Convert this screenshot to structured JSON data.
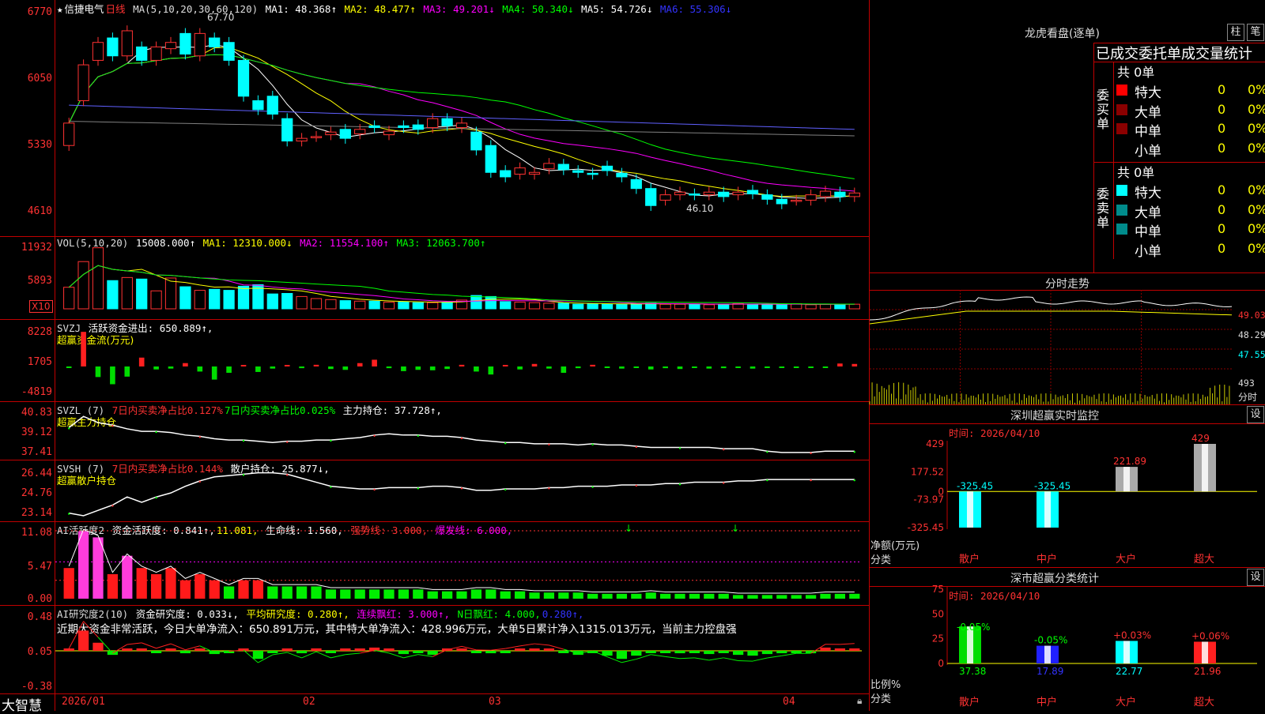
{
  "colors": {
    "up": "#ff3232",
    "down": "#00ffff",
    "ma1": "#ffffff",
    "ma2": "#ffff00",
    "ma3": "#ff00ff",
    "ma4": "#00ff00",
    "ma5": "#6060ff",
    "ma6": "#808080"
  },
  "main": {
    "star": "★",
    "stock_name": "信捷电气",
    "period": "日线",
    "ma_def": "MA(5,10,20,30,60,120)",
    "ma1": "MA1: 48.368↑",
    "ma2": "MA2: 48.477↑",
    "ma3": "MA3: 49.201↓",
    "ma4": "MA4: 50.340↓",
    "ma5": "MA5: 54.726↓",
    "ma6": "MA6: 55.306↓",
    "yticks": [
      "6770",
      "6050",
      "5330",
      "4610"
    ],
    "high_label": "67.70",
    "low_label": "46.10",
    "closes": [
      55.5,
      62.0,
      64.5,
      63.0,
      65.8,
      62.5,
      64.0,
      64.5,
      63.2,
      65.5,
      64.0,
      62.5,
      58.5,
      57.0,
      56.5,
      53.5,
      53.8,
      54.0,
      54.5,
      53.8,
      54.8,
      55.0,
      54.6,
      55.0,
      54.8,
      56.0,
      55.2,
      55.5,
      52.5,
      50.0,
      49.5,
      50.5,
      50.0,
      51.0,
      50.3,
      50.0,
      49.8,
      50.2,
      49.5,
      48.2,
      46.3,
      47.5,
      47.8,
      47.5,
      47.8,
      47.3,
      47.8,
      47.6,
      47.0,
      46.5,
      46.9,
      47.5,
      47.9,
      47.3,
      47.7
    ],
    "opens": [
      53.0,
      58.0,
      62.5,
      65.0,
      63.0,
      64.0,
      62.5,
      63.8,
      65.5,
      63.0,
      65.0,
      64.5,
      62.5,
      58.0,
      58.5,
      56.0,
      53.5,
      54.0,
      54.2,
      54.8,
      54.3,
      55.2,
      54.2,
      55.2,
      55.3,
      55.0,
      56.0,
      55.0,
      54.5,
      53.0,
      50.2,
      49.8,
      49.8,
      50.4,
      50.9,
      50.2,
      49.9,
      50.7,
      49.9,
      49.2,
      48.2,
      46.9,
      47.5,
      47.6,
      47.5,
      47.8,
      47.5,
      48.0,
      47.5,
      47.0,
      46.9,
      46.9,
      47.3,
      47.8,
      47.3
    ]
  },
  "vol": {
    "hdr_def": "VOL(5,10,20)",
    "vol": "15008.000↑",
    "ma1": "MA1: 12310.000↓",
    "ma2": "MA2: 11554.100↑",
    "ma3": "MA3: 12063.700↑",
    "yticks": [
      "11932",
      "5893"
    ],
    "x10": "X10",
    "values": [
      4200,
      9200,
      11900,
      5500,
      6100,
      5800,
      3500,
      6000,
      4300,
      3600,
      3800,
      3600,
      4400,
      4700,
      2900,
      3000,
      2400,
      2000,
      1800,
      1600,
      1500,
      1500,
      1300,
      1300,
      1200,
      1200,
      1300,
      1700,
      2600,
      2400,
      1400,
      1300,
      1200,
      1100,
      1100,
      900,
      1000,
      900,
      900,
      1000,
      1100,
      900,
      900,
      900,
      800,
      900,
      1000,
      900,
      800,
      900,
      1000,
      800,
      900,
      900,
      900
    ]
  },
  "svzj": {
    "name": "SVZJ",
    "label": "活跃资金进出: 650.889↑,",
    "sub": "超赢资金流(万元)",
    "yticks": [
      "8228",
      "1705",
      "-4819"
    ],
    "values": [
      -300,
      8200,
      -2500,
      -4200,
      -2400,
      2100,
      -700,
      -500,
      800,
      -1200,
      -3100,
      -1500,
      200,
      -1300,
      -500,
      200,
      -400,
      400,
      -600,
      -800,
      800,
      1600,
      -400,
      -1100,
      -800,
      -900,
      -600,
      400,
      -1200,
      -1900,
      200,
      -700,
      600,
      -500,
      -1500,
      -400,
      400,
      -300,
      -500,
      -300,
      -700,
      -400,
      -600,
      -300,
      -500,
      -400,
      -300,
      -500,
      -200,
      -300,
      -200,
      -300,
      -200,
      700,
      600
    ]
  },
  "svzl": {
    "name": "SVZL (7)",
    "r1": "7日内买卖净占比0.127%",
    "r2": "7日内买卖净占比0.025%",
    "main": "主力持仓: 37.728↑,",
    "sub": "超赢主力持仓",
    "yticks": [
      "40.83",
      "39.12",
      "37.41"
    ],
    "values": [
      39.6,
      40.5,
      40.0,
      39.8,
      39.5,
      39.3,
      39.3,
      39.2,
      39.0,
      38.9,
      38.7,
      38.6,
      38.6,
      38.5,
      38.4,
      38.5,
      38.5,
      38.6,
      38.6,
      38.7,
      38.8,
      39.0,
      39.1,
      39.0,
      39.0,
      38.9,
      38.9,
      38.8,
      38.6,
      38.5,
      38.4,
      38.4,
      38.3,
      38.3,
      38.3,
      38.2,
      38.3,
      38.2,
      38.2,
      38.1,
      38.0,
      38.0,
      38.0,
      38.0,
      38.0,
      37.9,
      37.9,
      37.9,
      37.7,
      37.6,
      37.6,
      37.6,
      37.7,
      37.7,
      37.7
    ]
  },
  "svsh": {
    "name": "SVSH (7)",
    "r1": "7日内买卖净占比0.144%",
    "main": "散户持仓: 25.877↓,",
    "sub": "超赢散户持仓",
    "yticks": [
      "26.44",
      "24.76",
      "23.14"
    ],
    "values": [
      23.4,
      23.2,
      23.6,
      24.0,
      24.6,
      24.2,
      24.6,
      24.9,
      25.4,
      25.8,
      26.1,
      26.2,
      26.3,
      26.4,
      26.4,
      26.3,
      26.0,
      25.7,
      25.4,
      25.3,
      25.2,
      25.2,
      25.3,
      25.3,
      25.3,
      25.4,
      25.4,
      25.3,
      25.1,
      25.1,
      25.2,
      25.2,
      25.2,
      25.3,
      25.3,
      25.4,
      25.4,
      25.4,
      25.5,
      25.5,
      25.5,
      25.6,
      25.6,
      25.7,
      25.7,
      25.7,
      25.8,
      25.8,
      25.9,
      25.9,
      25.9,
      25.9,
      25.9,
      25.9,
      25.9
    ]
  },
  "ai": {
    "name": "AI活跃度2",
    "act": "资金活跃度: 0.841↑,",
    "v2": "11.081,",
    "life": "生命线: 1.560,",
    "strong": "强势线: 3.000,",
    "burst": "爆发线: 6.000,",
    "yticks": [
      "11.08",
      "5.47",
      "0.00"
    ],
    "values": [
      5,
      11,
      10,
      4,
      7,
      5,
      4,
      5,
      3,
      4,
      3,
      2,
      3,
      3,
      2,
      2,
      2,
      2,
      1.5,
      1.5,
      1.5,
      1.5,
      1.5,
      1.5,
      1.5,
      1.2,
      1.2,
      1.2,
      1.5,
      1.5,
      1.2,
      1.2,
      1,
      1,
      1,
      1,
      0.8,
      0.8,
      0.8,
      0.8,
      1,
      0.8,
      0.8,
      0.8,
      0.8,
      0.8,
      0.6,
      0.6,
      0.6,
      0.6,
      0.6,
      0.6,
      0.8,
      0.8,
      0.8
    ]
  },
  "research": {
    "name": "AI研究度2(10)",
    "fund": "资金研究度: 0.033↓,",
    "avg": "平均研究度: 0.280↑,",
    "red": "连续飘红: 3.000↑,",
    "nred": "N日飘红: 4.000,",
    "last": "0.280↑,",
    "desc": "近期大资金非常活跃，今日大单净流入：650.891万元，其中特大单净流入：428.996万元，大单5日累计净入1315.013万元，当前主力控盘强",
    "yticks": [
      "0.48",
      "0.05",
      "-0.38"
    ],
    "values": [
      0.02,
      0.25,
      0.1,
      -0.05,
      0.02,
      0.03,
      -0.02,
      0.02,
      -0.03,
      0.01,
      -0.04,
      -0.02,
      0.0,
      -0.1,
      -0.02,
      0.01,
      -0.03,
      0.03,
      -0.02,
      0.01,
      0.02,
      0.04,
      0.01,
      -0.04,
      -0.02,
      -0.05,
      0.0,
      0.02,
      -0.02,
      -0.03,
      -0.02,
      0.0,
      0.02,
      0.01,
      -0.02,
      -0.05,
      -0.02,
      -0.06,
      -0.1,
      -0.06,
      -0.01,
      -0.02,
      -0.03,
      -0.02,
      -0.04,
      -0.02,
      -0.05,
      -0.06,
      -0.04,
      -0.03,
      -0.02,
      -0.03,
      0.04,
      0.03,
      0.03
    ]
  },
  "xaxis": {
    "brand": "大智慧",
    "labels": [
      "2026/01",
      "02",
      "03",
      "04"
    ]
  },
  "dragon": {
    "title": "龙虎看盘(逐单)",
    "btn1": "柱",
    "btn2": "笔",
    "section_title": "已成交委托单成交量统计",
    "buy": "委买单",
    "sell": "委卖单",
    "total": "共 0单",
    "rows": [
      {
        "name": "特大",
        "v": "0",
        "p": "0%"
      },
      {
        "name": "大单",
        "v": "0",
        "p": "0%"
      },
      {
        "name": "中单",
        "v": "0",
        "p": "0%"
      },
      {
        "name": "小单",
        "v": "0",
        "p": "0%"
      }
    ],
    "buy_colors": [
      "#ff0000",
      "#8b0000",
      "#8b0000",
      "#000000"
    ],
    "sell_colors": [
      "#00ffff",
      "#008b8b",
      "#008b8b",
      "#000000"
    ]
  },
  "intraday": {
    "title": "分时走势",
    "yticks": [
      "49.03",
      "48.29",
      "47.55"
    ],
    "vol_tick": "493",
    "vol_lbl": "分时"
  },
  "szmon": {
    "title": "深圳超赢实时监控",
    "btn": "设",
    "date": "时间: 2026/04/10",
    "yticks": [
      "429",
      "177.52",
      "0",
      "-73.97",
      "-325.45"
    ],
    "ylabel": "净额(万元)",
    "xlabel": "分类",
    "cats": [
      "散户",
      "中户",
      "大户",
      "超大"
    ],
    "values": [
      -325.45,
      -325.45,
      221.89,
      429
    ],
    "labels": [
      "-325.45",
      "-325.45",
      "221.89",
      "429"
    ]
  },
  "szstat": {
    "title": "深市超赢分类统计",
    "btn": "设",
    "date": "时间: 2026/04/10",
    "yticks": [
      "75",
      "50",
      "25",
      "0"
    ],
    "ylabel": "比例%",
    "xlabel": "分类",
    "cats": [
      "散户",
      "中户",
      "大户",
      "超大"
    ],
    "values": [
      37.38,
      17.89,
      22.77,
      21.96
    ],
    "changes": [
      "-0.05%",
      "-0.05%",
      "+0.03%",
      "+0.06%"
    ],
    "vals_text": [
      "37.38",
      "17.89",
      "22.77",
      "21.96"
    ]
  }
}
